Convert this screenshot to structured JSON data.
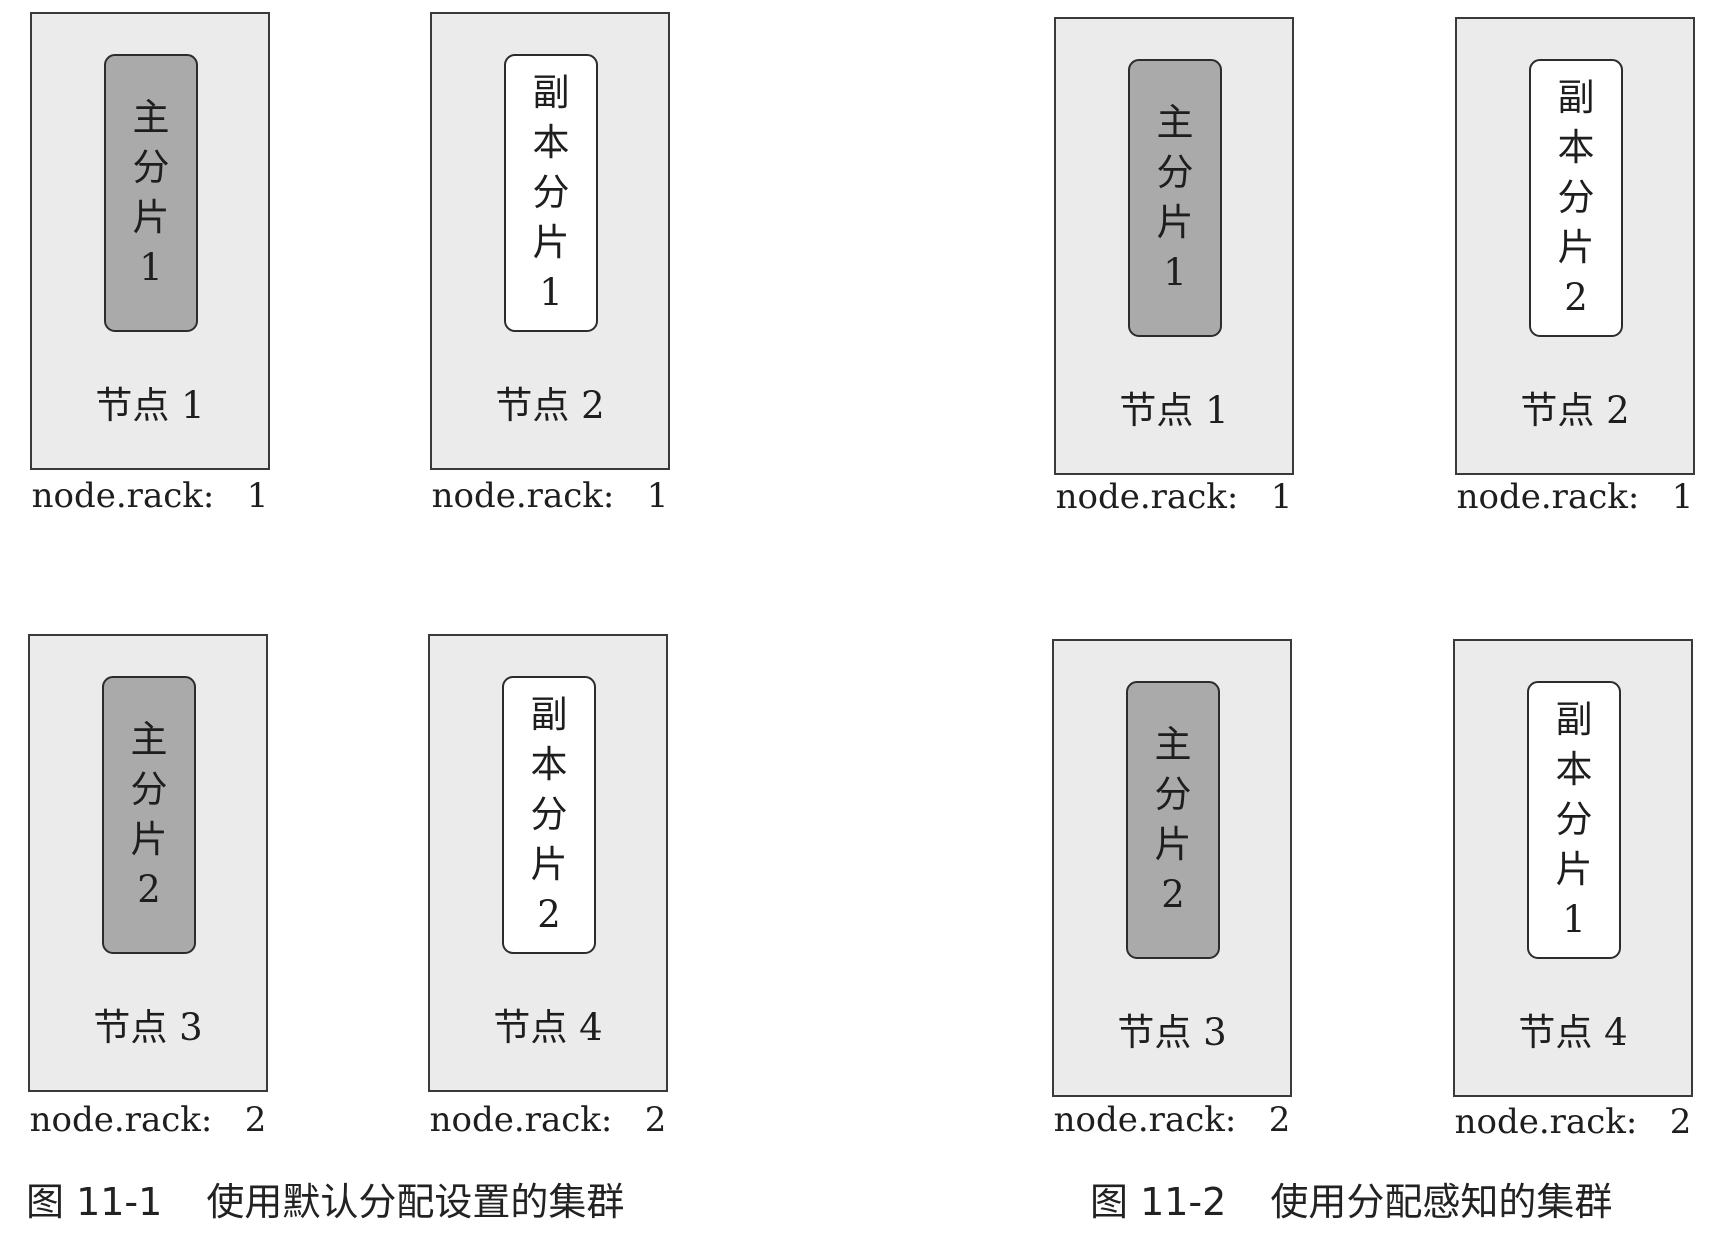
{
  "figures": [
    {
      "caption_number": "图 11-1",
      "caption_text": "使用默认分配设置的集群",
      "nodes": [
        {
          "shard_type": "primary",
          "shard_chars": [
            "主",
            "分",
            "片",
            "1"
          ],
          "label": "节点 1",
          "rack": "node.rack:   1"
        },
        {
          "shard_type": "replica",
          "shard_chars": [
            "副",
            "本",
            "分",
            "片",
            "1"
          ],
          "label": "节点 2",
          "rack": "node.rack:   1"
        },
        {
          "shard_type": "primary",
          "shard_chars": [
            "主",
            "分",
            "片",
            "2"
          ],
          "label": "节点 3",
          "rack": "node.rack:   2"
        },
        {
          "shard_type": "replica",
          "shard_chars": [
            "副",
            "本",
            "分",
            "片",
            "2"
          ],
          "label": "节点  4",
          "rack": "node.rack:   2"
        }
      ]
    },
    {
      "caption_number": "图 11-2",
      "caption_text": "使用分配感知的集群",
      "nodes": [
        {
          "shard_type": "primary",
          "shard_chars": [
            "主",
            "分",
            "片",
            "1"
          ],
          "label": "节点 1",
          "rack": "node.rack:   1"
        },
        {
          "shard_type": "replica",
          "shard_chars": [
            "副",
            "本",
            "分",
            "片",
            "2"
          ],
          "label": "节点 2",
          "rack": "node.rack:   1"
        },
        {
          "shard_type": "primary",
          "shard_chars": [
            "主",
            "分",
            "片",
            "2"
          ],
          "label": "节点 3",
          "rack": "node.rack:   2"
        },
        {
          "shard_type": "replica",
          "shard_chars": [
            "副",
            "本",
            "分",
            "片",
            "1"
          ],
          "label": "节点  4",
          "rack": "node.rack:   2"
        }
      ]
    }
  ],
  "colors": {
    "node_fill": "#ebebeb",
    "primary_shard_fill": "#aaaaaa",
    "replica_shard_fill": "#ffffff",
    "border": "#3a3a3a"
  }
}
